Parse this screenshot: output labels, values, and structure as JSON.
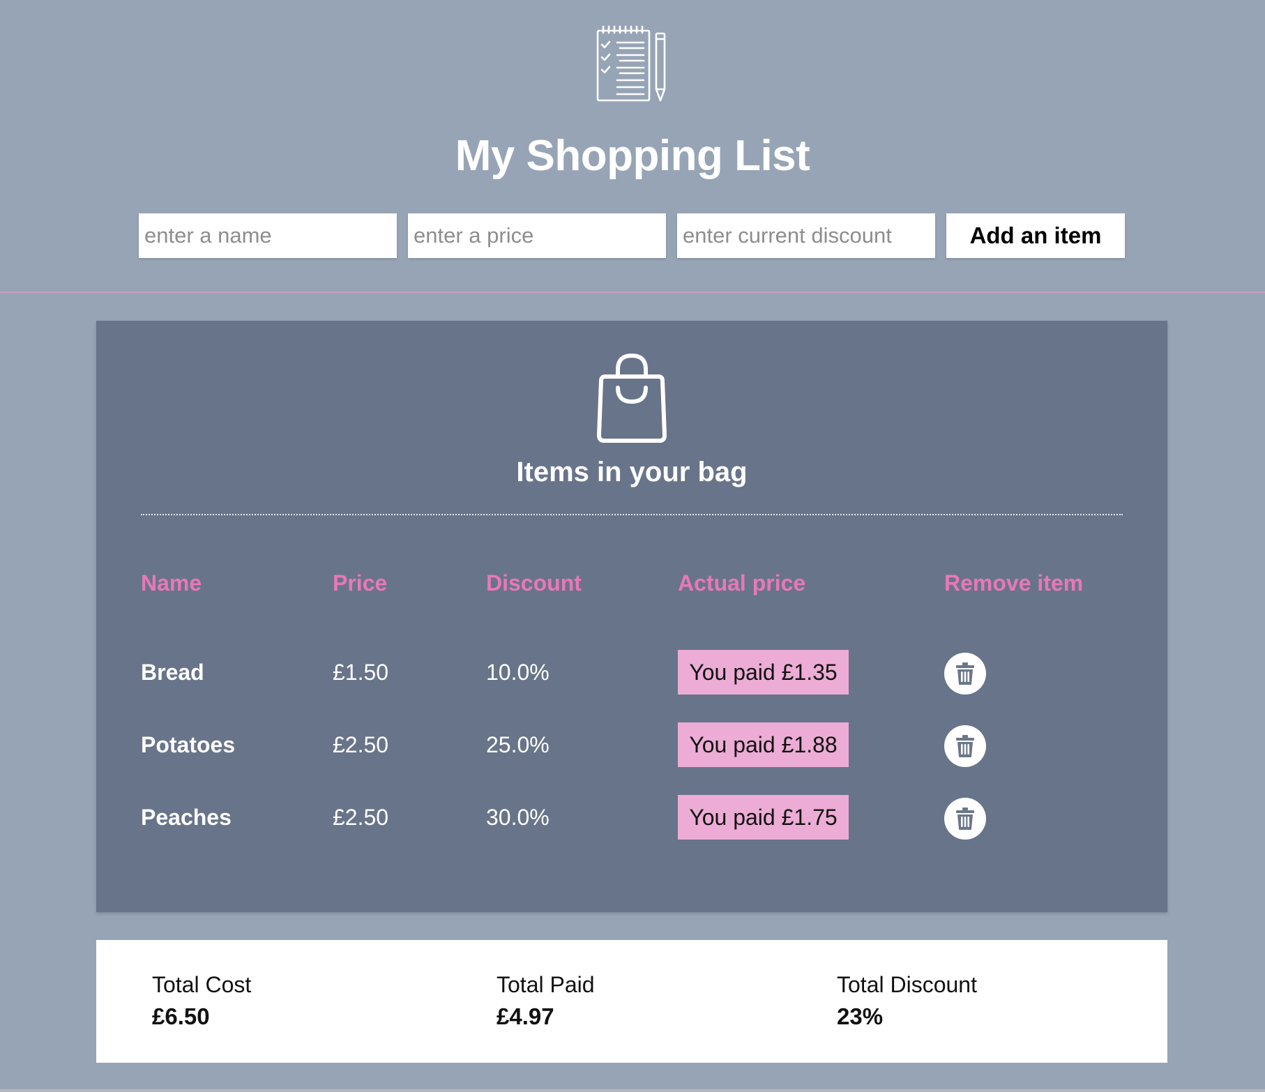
{
  "header": {
    "logo_icon": "shopping-list-notepad-icon",
    "title": "My Shopping List"
  },
  "form": {
    "name_placeholder": "enter a name",
    "price_placeholder": "enter a price",
    "discount_placeholder": "enter current discount",
    "add_label": "Add an item"
  },
  "bag": {
    "icon": "shopping-bag-icon",
    "title": "Items in your bag",
    "columns": [
      "Name",
      "Price",
      "Discount",
      "Actual price",
      "Remove item"
    ],
    "items": [
      {
        "name": "Bread",
        "price": "£1.50",
        "discount": "10.0%",
        "paid": "You paid £1.35"
      },
      {
        "name": "Potatoes",
        "price": "£2.50",
        "discount": "25.0%",
        "paid": "You paid £1.88"
      },
      {
        "name": "Peaches",
        "price": "£2.50",
        "discount": "30.0%",
        "paid": "You paid £1.75"
      }
    ],
    "remove_icon": "trash-icon"
  },
  "totals": {
    "cost_label": "Total Cost",
    "cost_value": "£6.50",
    "paid_label": "Total Paid",
    "paid_value": "£4.97",
    "discount_label": "Total Discount",
    "discount_value": "23%"
  },
  "colors": {
    "page_bg": "#97a4b6",
    "panel_bg": "#687489",
    "accent_pink": "#e878b8",
    "badge_pink": "#ecacd5"
  }
}
